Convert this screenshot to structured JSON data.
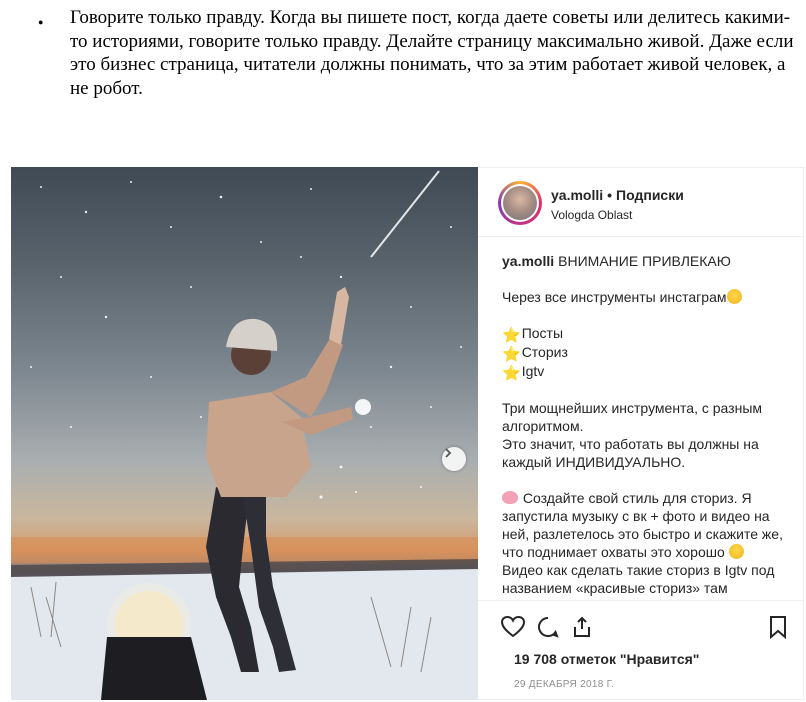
{
  "document": {
    "bullet": "●",
    "paragraph": "Говорите только правду. Когда вы пишете пост, когда даете советы или делитесь какими-то историями, говорите только правду. Делайте страницу максимально живой. Даже если это бизнес страница, читатели должны понимать, что за этим работает живой человек, а не робот."
  },
  "post": {
    "username": "ya.molli",
    "separator": "•",
    "follow_label": "Подписки",
    "location": "Vologda Oblast",
    "caption": {
      "username": "ya.molli",
      "line1": "ВНИМАНИЕ ПРИВЛЕКАЮ",
      "line2": "Через все инструменты инстаграм",
      "item1": "Посты",
      "item2": "Сториз",
      "item3": "Igtv",
      "para1": "Три мощнейших инструмента, с разным алгоритмом.",
      "para2": "Это значит, что работать вы должны на каждый ИНДИВИДУАЛЬНО.",
      "para3": "Создайте свой стиль для сториз. Я запустила музыку с вк + фото и видео на ней, разлетелось это быстро и скажите же, что поднимает охваты это хорошо",
      "para4": "Видео как сделать такие сториз в Igtv под названием «красивые сториз» там"
    },
    "likes": "19 708 отметок \"Нравится\"",
    "date": "29 ДЕКАБРЯ 2018 Г.",
    "icons": {
      "like": "heart-icon",
      "comment": "comment-icon",
      "share": "share-icon",
      "save": "bookmark-icon",
      "next": "chevron-right-icon"
    }
  }
}
